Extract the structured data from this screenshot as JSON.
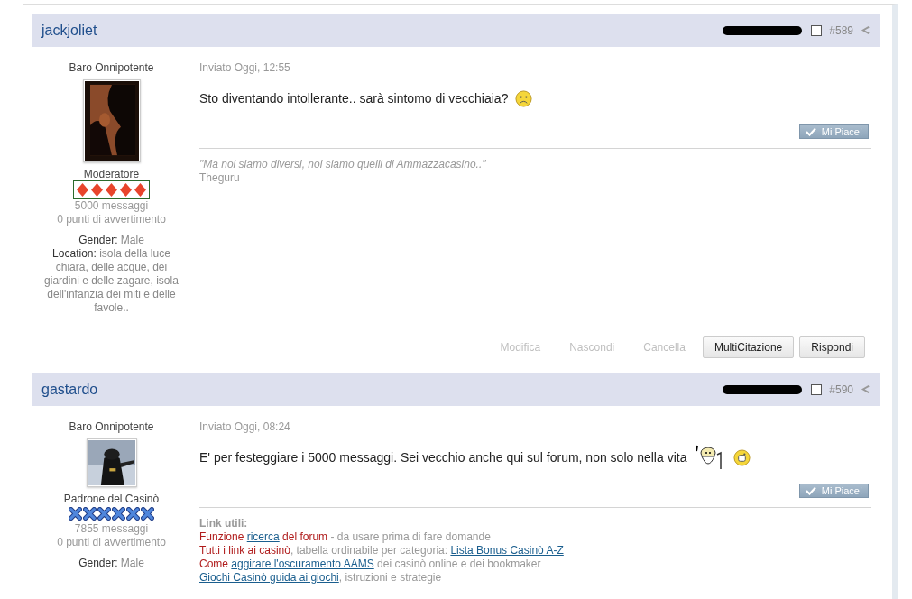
{
  "posts": [
    {
      "author": "jackjoliet",
      "post_number": "#589",
      "checked": false,
      "rank_title": "Baro Onnipotente",
      "avatar": {
        "kind": "picture"
      },
      "group": "Moderatore",
      "pips": {
        "kind": "diamond",
        "stars": 5
      },
      "post_count": "5000 messaggi",
      "warning_points": "0 punti di avvertimento",
      "profile_fields": [
        {
          "label": "Gender:",
          "value": "Male"
        },
        {
          "label": "Location:",
          "value": "isola della luce chiara, delle acque, dei giardini e delle zagare, isola dell'infanzia dei miti e delle favole.."
        }
      ],
      "posted": "Inviato Oggi, 12:55",
      "text": "Sto diventando intollerante.. sarà sintomo di vecchiaia?",
      "emoticons": [
        {
          "kind": "sad"
        }
      ],
      "like_label": "Mi Piace!",
      "signature": [
        [
          {
            "kind": "quote",
            "text": "\"Ma noi siamo diversi, noi siamo quelli di Ammazzacasino..\""
          }
        ],
        [
          {
            "kind": "plain",
            "text": "Theguru"
          }
        ]
      ],
      "actions": [
        {
          "label": "Modifica",
          "disabled": true
        },
        {
          "label": "Nascondi",
          "disabled": true
        },
        {
          "label": "Cancella",
          "disabled": true
        },
        {
          "label": "MultiCitazione",
          "disabled": false
        },
        {
          "label": "Rispondi",
          "disabled": false
        }
      ]
    },
    {
      "author": "gastardo",
      "post_number": "#590",
      "checked": false,
      "rank_title": "Baro Onnipotente",
      "avatar": {
        "kind": "picture"
      },
      "group": "Padrone del Casinò",
      "pips": {
        "kind": "cross",
        "stars": 6
      },
      "post_count": "7855 messaggi",
      "warning_points": "0 punti di avvertimento",
      "profile_fields": [
        {
          "label": "Gender:",
          "value": "Male"
        }
      ],
      "posted": "Inviato Oggi, 08:24",
      "text": "E' per festeggiare i 5000 messaggi. Sei vecchio anche qui sul forum, non solo nella vita",
      "emoticons": [
        {
          "kind": "old-man"
        },
        {
          "kind": "grin"
        }
      ],
      "like_label": "Mi Piace!",
      "signature": [
        [
          {
            "kind": "heading",
            "text": "Link utili:"
          }
        ],
        [
          {
            "kind": "red",
            "text": "Funzione "
          },
          {
            "kind": "link",
            "text": "ricerca"
          },
          {
            "kind": "red",
            "text": " del forum"
          },
          {
            "kind": "plain",
            "text": " - da usare prima di fare domande"
          }
        ],
        [
          {
            "kind": "red",
            "text": "Tutti i link ai casinò"
          },
          {
            "kind": "plain",
            "text": ", tabella ordinabile per categoria: "
          },
          {
            "kind": "link",
            "text": "Lista Bonus Casinò A-Z"
          }
        ],
        [
          {
            "kind": "red",
            "text": "Come "
          },
          {
            "kind": "link",
            "text": "aggirare l'oscuramento AAMS"
          },
          {
            "kind": "plain",
            "text": " dei casinò online e dei bookmaker"
          }
        ],
        [
          {
            "kind": "link",
            "text": "Giochi Casinò guida ai giochi"
          },
          {
            "kind": "plain",
            "text": ", istruzioni e strategie"
          }
        ]
      ]
    }
  ]
}
